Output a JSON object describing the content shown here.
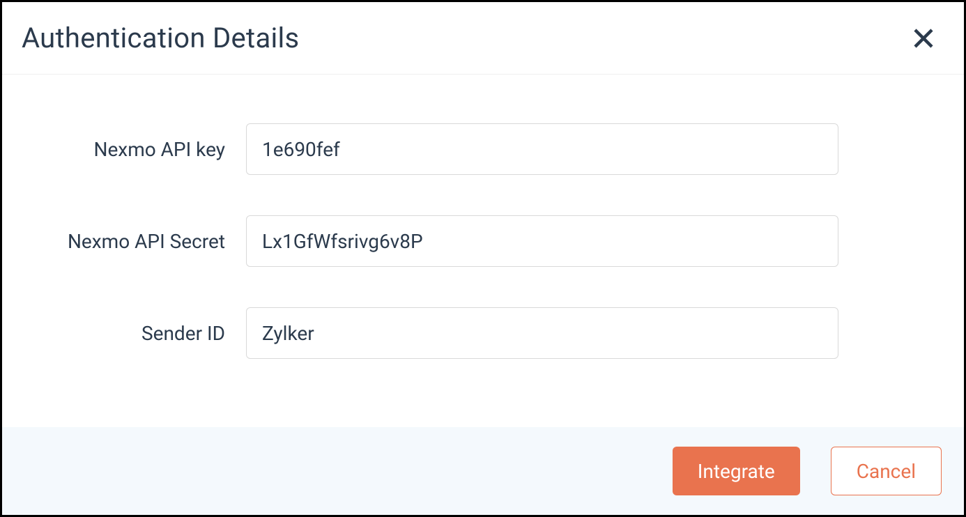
{
  "modal": {
    "title": "Authentication Details",
    "fields": {
      "api_key": {
        "label": "Nexmo API key",
        "value": "1e690fef"
      },
      "api_secret": {
        "label": "Nexmo API Secret",
        "value": "Lx1GfWfsrivg6v8P"
      },
      "sender_id": {
        "label": "Sender ID",
        "value": "Zylker"
      }
    },
    "buttons": {
      "primary": "Integrate",
      "secondary": "Cancel"
    }
  }
}
